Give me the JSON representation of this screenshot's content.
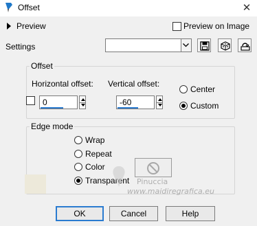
{
  "window": {
    "title": "Offset",
    "close_glyph": "✕",
    "app_icon": "paint-brush-icon"
  },
  "preview": {
    "label": "Preview",
    "preview_on_image_label": "Preview on Image",
    "preview_on_image_checked": false
  },
  "settings": {
    "label": "Settings",
    "value": ""
  },
  "offset": {
    "group_label": "Offset",
    "horizontal_label": "Horizontal offset:",
    "horizontal_value": "0",
    "vertical_label": "Vertical offset:",
    "vertical_value": "-60",
    "center_label": "Center",
    "custom_label": "Custom",
    "selected": "Custom",
    "link_checked": false
  },
  "edge_mode": {
    "group_label": "Edge mode",
    "options": [
      "Wrap",
      "Repeat",
      "Color",
      "Transparent"
    ],
    "selected": "Transparent",
    "fill_swatch_color": "#ede9da"
  },
  "buttons": {
    "ok": "OK",
    "cancel": "Cancel",
    "help": "Help"
  },
  "watermark": {
    "name": "Pinuccia",
    "site": "www.maidiregrafica.eu"
  },
  "colors": {
    "accent": "#2a7bd0",
    "dialog_bg": "#f0f0f0"
  }
}
